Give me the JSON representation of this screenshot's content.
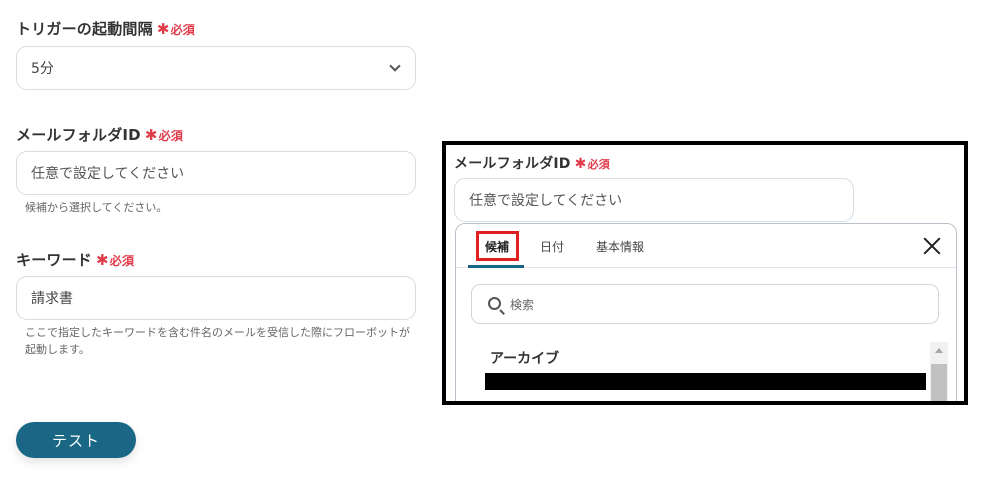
{
  "form": {
    "required_star": "✱",
    "required_text": "必須",
    "trigger_interval": {
      "label": "トリガーの起動間隔",
      "selected": "5分"
    },
    "mail_folder": {
      "label": "メールフォルダID",
      "placeholder": "任意で設定してください",
      "help": "候補から選択してください。"
    },
    "keyword": {
      "label": "キーワード",
      "value": "請求書",
      "help_line1": "ここで指定したキーワードを含む件名のメールを受信した際にフローボットが",
      "help_line2": "起動します。"
    },
    "test_button": "テスト"
  },
  "inset": {
    "label": "メールフォルダID",
    "placeholder": "任意で設定してください",
    "tabs": [
      "候補",
      "日付",
      "基本情報"
    ],
    "search_placeholder": "検索",
    "list_items": [
      "アーカイブ"
    ]
  },
  "colors": {
    "accent": "#1a6785",
    "required": "#e03c4a",
    "highlight": "#e02020"
  }
}
